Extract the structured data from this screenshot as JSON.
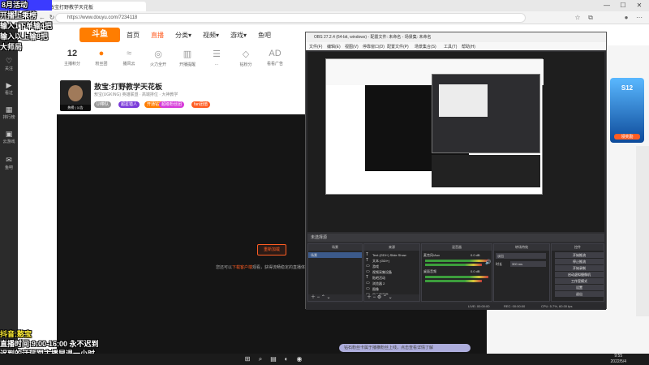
{
  "browser": {
    "tab_title": "敖宝(UGKING)直播_敖宝打野教学天花板",
    "url": "https://www.douyu.com/7234118",
    "win_controls": [
      "—",
      "☐",
      "✕"
    ]
  },
  "sidebar": {
    "items": [
      {
        "icon": "♡",
        "label": "关注"
      },
      {
        "icon": "▶",
        "label": "看过"
      },
      {
        "icon": "▦",
        "label": "排行榜"
      },
      {
        "icon": "▣",
        "label": "云游戏"
      },
      {
        "icon": "✉",
        "label": "鱼吧"
      }
    ]
  },
  "douyu": {
    "logo": "斗鱼",
    "nav": [
      "首页",
      "直播",
      "分类▾",
      "视频▾",
      "游戏▾",
      "鱼吧"
    ],
    "categories": [
      {
        "icon": "12",
        "label": "主播积分"
      },
      {
        "icon": "●",
        "label": "粉丝团"
      },
      {
        "icon": "≈",
        "label": "播风云"
      },
      {
        "icon": "◎",
        "label": "火力全开"
      },
      {
        "icon": "▥",
        "label": "开播提醒"
      },
      {
        "icon": "☰",
        "label": "..."
      },
      {
        "icon": "◇",
        "label": "钻粉分"
      },
      {
        "icon": "AD",
        "label": "看看广告"
      },
      {
        "icon": "◌",
        "label": "..."
      }
    ]
  },
  "room": {
    "title": "敖宝:打野教学天花板",
    "meta": "敖宝(UGKING)  英雄联盟 · 高端排位 · 大神教学",
    "avatar_badge": "热榜 | 公告",
    "badges": [
      "UI带队",
      "超星猎人",
      "开通钻粉",
      "超级粉丝团",
      "fan团值"
    ],
    "video_error_btn": "重新加载",
    "video_error_msg_pre": "您还可以",
    "video_error_msg_link": "下载客户端",
    "video_error_msg_post": "观看，获得流畅稳定的直播体验"
  },
  "promo": {
    "title": "S12",
    "subtitle": "领奖励"
  },
  "obs": {
    "title": "OBS 27.2.4 (64-bit, windows) - 配置文件: 未命名 - 场景集: 未命名",
    "menus": [
      "文件(F)",
      "编辑(E)",
      "视图(V)",
      "停靠窗口(D)",
      "配置文件(P)",
      "场景集合(S)",
      "工具(T)",
      "帮助(H)"
    ],
    "source_bar": "未选择源",
    "docks": {
      "scenes": "场景",
      "sources": "来源",
      "mixer": "混音器",
      "transitions": "转场特效",
      "controls": "控件"
    },
    "scene_items": [
      "场景"
    ],
    "source_items": [
      {
        "icon": "T",
        "label": "Text (GDI+) Slide Show"
      },
      {
        "icon": "T",
        "label": "文本 (GDI+)"
      },
      {
        "icon": "▭",
        "label": "游戏"
      },
      {
        "icon": "▭",
        "label": "视频采集设备"
      },
      {
        "icon": "T",
        "label": "贴吧活动"
      },
      {
        "icon": "▭",
        "label": "浏览器 2"
      },
      {
        "icon": "▭",
        "label": "图像"
      },
      {
        "icon": "▭",
        "label": "显示器采集"
      },
      {
        "icon": "▭",
        "label": "显示器采集"
      }
    ],
    "mixer": [
      {
        "name": "麦克风/Aux",
        "db": "0.0 dB"
      },
      {
        "name": "桌面音频",
        "db": "0.0 dB"
      }
    ],
    "transition": {
      "type": "淡出",
      "duration_label": "时长",
      "duration": "300 ms"
    },
    "controls": [
      "开始推流",
      "停止推流",
      "开始录制",
      "启动虚拟摄像机",
      "工作室模式",
      "设置",
      "退出"
    ],
    "status": {
      "live": "LIVE: 00:00:00",
      "rec": "REC: 00:00:00",
      "cpu": "CPU: 5.7%, 60.00 fps"
    }
  },
  "overlay": {
    "top_lines": [
      "8月活动",
      "开播上乘榜",
      "输入1下单输4把",
      "输入以上输8把",
      "大师局"
    ],
    "bottom_lines": [
      "抖音:憨宝",
      "直播时间:9:00-16:00 永不迟到",
      "迟到的话惩罚主播早退一小时"
    ]
  },
  "danmaku_text": "钻石粉丝卡属于播横粉丝上线，点击查看详情了解",
  "taskbar": {
    "time": "9:55",
    "date": "2022/5/4"
  }
}
